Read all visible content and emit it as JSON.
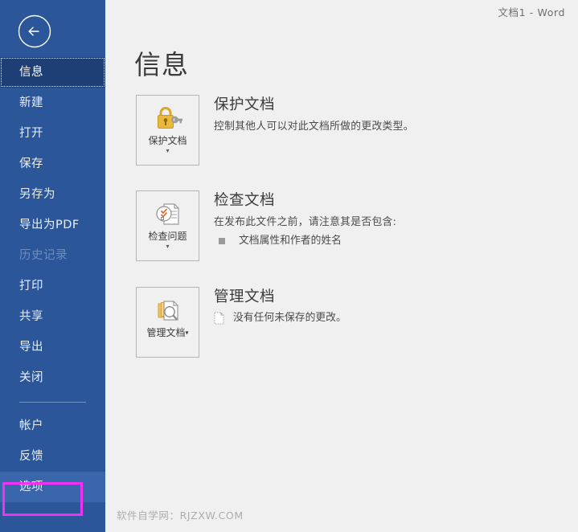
{
  "window": {
    "document_title": "文档1  -  Word"
  },
  "sidebar": {
    "back_icon": "back-arrow-icon",
    "items": [
      {
        "label": "信息",
        "state": "selected"
      },
      {
        "label": "新建",
        "state": "normal"
      },
      {
        "label": "打开",
        "state": "normal"
      },
      {
        "label": "保存",
        "state": "normal"
      },
      {
        "label": "另存为",
        "state": "normal"
      },
      {
        "label": "导出为PDF",
        "state": "normal"
      },
      {
        "label": "历史记录",
        "state": "disabled"
      },
      {
        "label": "打印",
        "state": "normal"
      },
      {
        "label": "共享",
        "state": "normal"
      },
      {
        "label": "导出",
        "state": "normal"
      },
      {
        "label": "关闭",
        "state": "normal"
      }
    ],
    "items_bottom": [
      {
        "label": "帐户",
        "state": "normal"
      },
      {
        "label": "反馈",
        "state": "normal"
      },
      {
        "label": "选项",
        "state": "hover"
      }
    ],
    "highlight_color": "#f22ff2",
    "background_color": "#2b579a",
    "selected_color": "#1e3f76"
  },
  "main": {
    "heading": "信息",
    "sections": [
      {
        "card_label": "保护文档",
        "card_icon": "lock-key-icon",
        "card_caret": "▾",
        "title": "保护文档",
        "desc": "控制其他人可以对此文档所做的更改类型。"
      },
      {
        "card_label": "检查问题",
        "card_icon": "document-check-icon",
        "card_caret": "▾",
        "title": "检查文档",
        "desc": "在发布此文件之前，请注意其是否包含:",
        "bullet": "文档属性和作者的姓名"
      },
      {
        "card_label": "管理文档",
        "card_icon": "document-search-icon",
        "card_caret": "▾",
        "title": "管理文档",
        "info": "没有任何未保存的更改。",
        "info_icon": "unsaved-document-icon"
      }
    ]
  },
  "watermark": "软件自学网：RJZXW.COM"
}
